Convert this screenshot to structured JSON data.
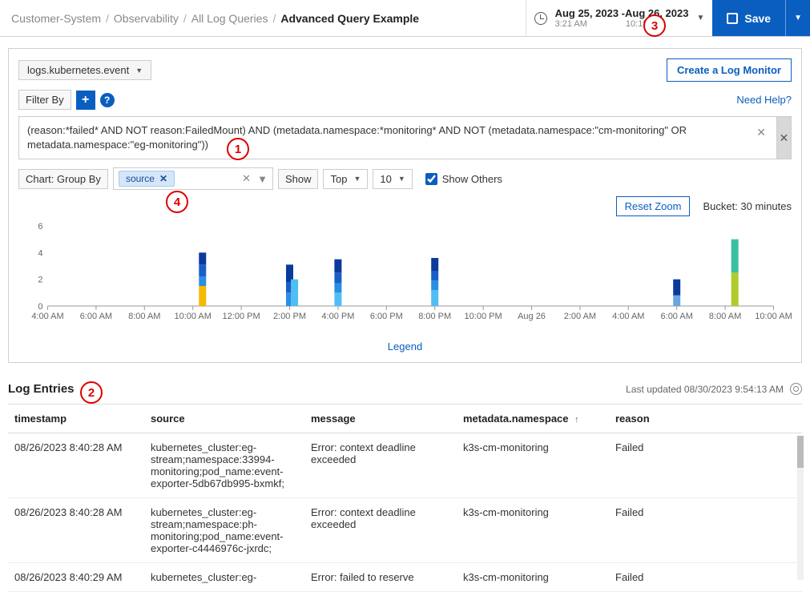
{
  "breadcrumb": {
    "seg1": "Customer-System",
    "seg2": "Observability",
    "seg3": "All Log Queries",
    "current": "Advanced Query Example"
  },
  "timerange": {
    "range_text": "Aug 25, 2023 -Aug 26, 2023",
    "start_time": "3:21 AM",
    "end_time": "10:15 AM"
  },
  "actions": {
    "save_label": "Save"
  },
  "query_panel": {
    "dataset": "logs.kubernetes.event",
    "create_monitor": "Create a Log Monitor",
    "filter_by": "Filter By",
    "need_help": "Need Help?",
    "query_text": "(reason:*failed* AND NOT reason:FailedMount) AND (metadata.namespace:*monitoring* AND NOT (metadata.namespace:\"cm-monitoring\" OR metadata.namespace:\"eg-monitoring\"))",
    "group_by_label": "Chart: Group By",
    "group_by_chip": "source",
    "show_label": "Show",
    "show_value": "Top",
    "show_count": "10",
    "show_others": "Show Others",
    "reset_zoom": "Reset Zoom",
    "bucket": "Bucket: 30 minutes",
    "legend": "Legend"
  },
  "chart_data": {
    "type": "bar",
    "ylim": [
      0,
      6
    ],
    "yticks": [
      0,
      2,
      4,
      6
    ],
    "xticks": [
      "4:00 AM",
      "6:00 AM",
      "8:00 AM",
      "10:00 AM",
      "12:00 PM",
      "2:00 PM",
      "4:00 PM",
      "6:00 PM",
      "8:00 PM",
      "10:00 PM",
      "Aug 26",
      "2:00 AM",
      "4:00 AM",
      "6:00 AM",
      "8:00 AM",
      "10:00 AM"
    ],
    "stacked_bars": [
      {
        "x_index": 3.2,
        "segments": [
          {
            "color": "#f5b900",
            "h": 1.5
          },
          {
            "color": "#2a8fe0",
            "h": 0.7
          },
          {
            "color": "#1a5fc8",
            "h": 0.9
          },
          {
            "color": "#0a3a9a",
            "h": 0.9
          }
        ]
      },
      {
        "x_index": 5.0,
        "segments": [
          {
            "color": "#2a8fe0",
            "h": 1.0
          },
          {
            "color": "#1a5fc8",
            "h": 0.8
          },
          {
            "color": "#0a3a9a",
            "h": 1.3
          }
        ]
      },
      {
        "x_index": 5.1,
        "segments": [
          {
            "color": "#4fbef2",
            "h": 2.0
          }
        ]
      },
      {
        "x_index": 6.0,
        "segments": [
          {
            "color": "#4fbef2",
            "h": 1.0
          },
          {
            "color": "#2a8fe0",
            "h": 0.7
          },
          {
            "color": "#1a5fc8",
            "h": 0.8
          },
          {
            "color": "#0a3a9a",
            "h": 1.0
          }
        ]
      },
      {
        "x_index": 8.0,
        "segments": [
          {
            "color": "#4fbef2",
            "h": 1.2
          },
          {
            "color": "#2a8fe0",
            "h": 0.7
          },
          {
            "color": "#1a5fc8",
            "h": 0.7
          },
          {
            "color": "#0a3a9a",
            "h": 1.0
          }
        ]
      },
      {
        "x_index": 13.0,
        "segments": [
          {
            "color": "#6aa7e0",
            "h": 0.8
          },
          {
            "color": "#0a3a9a",
            "h": 1.2
          }
        ]
      },
      {
        "x_index": 14.2,
        "segments": [
          {
            "color": "#b0cc2a",
            "h": 2.5
          },
          {
            "color": "#3ac0a0",
            "h": 2.5
          }
        ]
      }
    ]
  },
  "log_entries": {
    "title": "Log Entries",
    "last_updated": "Last updated 08/30/2023 9:54:13 AM",
    "columns": {
      "timestamp": "timestamp",
      "source": "source",
      "message": "message",
      "namespace": "metadata.namespace",
      "reason": "reason"
    },
    "rows": [
      {
        "timestamp": "08/26/2023 8:40:28 AM",
        "source": "kubernetes_cluster:eg-stream;namespace:33994-monitoring;pod_name:event-exporter-5db67db995-bxmkf;",
        "message": "Error: context deadline exceeded",
        "namespace": "k3s-cm-monitoring",
        "reason": "Failed"
      },
      {
        "timestamp": "08/26/2023 8:40:28 AM",
        "source": "kubernetes_cluster:eg-stream;namespace:ph-monitoring;pod_name:event-exporter-c4446976c-jxrdc;",
        "message": "Error: context deadline exceeded",
        "namespace": "k3s-cm-monitoring",
        "reason": "Failed"
      },
      {
        "timestamp": "08/26/2023 8:40:29 AM",
        "source": "kubernetes_cluster:eg-",
        "message": "Error: failed to reserve",
        "namespace": "k3s-cm-monitoring",
        "reason": "Failed"
      }
    ]
  },
  "callouts": {
    "c1": "1",
    "c2": "2",
    "c3": "3",
    "c4": "4"
  }
}
